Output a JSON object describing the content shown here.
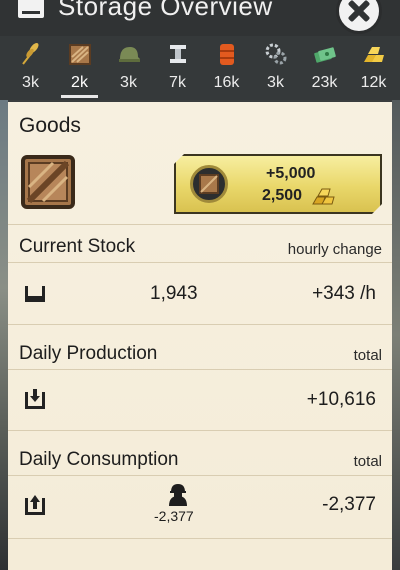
{
  "header": {
    "title": "Storage Overview"
  },
  "tabs": [
    {
      "icon": "wheat-icon",
      "value": "3k"
    },
    {
      "icon": "crate-icon",
      "value": "2k",
      "active": true
    },
    {
      "icon": "helmet-icon",
      "value": "3k"
    },
    {
      "icon": "iron-beam-icon",
      "value": "7k"
    },
    {
      "icon": "barrel-icon",
      "value": "16k"
    },
    {
      "icon": "gear-icon",
      "value": "3k"
    },
    {
      "icon": "cash-icon",
      "value": "23k"
    },
    {
      "icon": "gold-bars-icon",
      "value": "12k"
    }
  ],
  "goods": {
    "title": "Goods",
    "buy": {
      "amount": "+5,000",
      "cost": "2,500"
    }
  },
  "current_stock": {
    "title": "Current Stock",
    "right_label": "hourly change",
    "value": "1,943",
    "change": "+343 /h"
  },
  "daily_production": {
    "title": "Daily Production",
    "right_label": "total",
    "total": "+10,616"
  },
  "daily_consumption": {
    "title": "Daily Consumption",
    "right_label": "total",
    "soldier_value": "-2,377",
    "total": "-2,377"
  },
  "colors": {
    "panel": "#f4ecd8",
    "header": "#303334",
    "button_gold": "#e9d76a"
  }
}
